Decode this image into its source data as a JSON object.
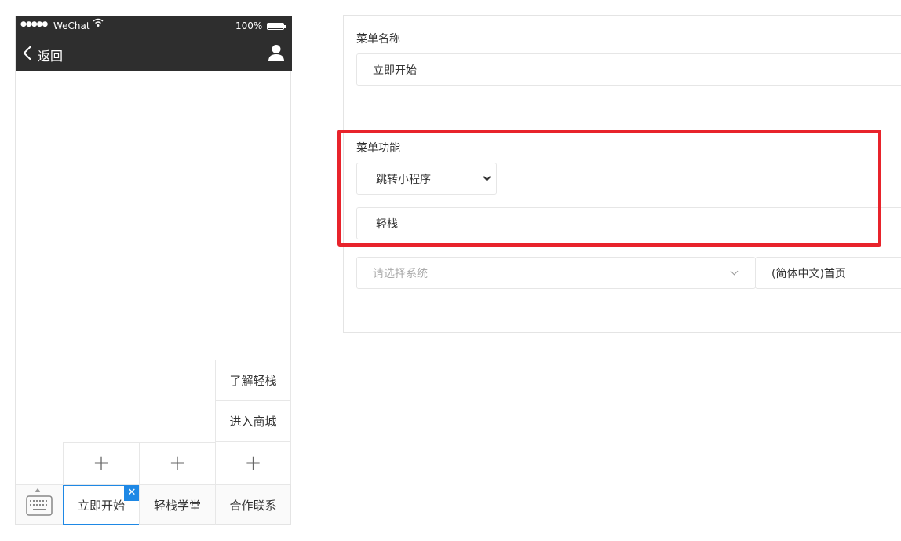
{
  "phone": {
    "status_bar": {
      "signal": "●●●●●",
      "carrier": "WeChat",
      "battery_percent": "100%"
    },
    "nav": {
      "back_label": "返回"
    },
    "submenu": [
      "了解轻栈",
      "进入商城"
    ],
    "add_symbol": "+",
    "main_menu": [
      {
        "label": "立即开始",
        "active": true
      },
      {
        "label": "轻栈学堂",
        "active": false
      },
      {
        "label": "合作联系",
        "active": false
      }
    ],
    "delete_symbol": "✕"
  },
  "form": {
    "menu_name_label": "菜单名称",
    "menu_name_value": "立即开始",
    "menu_function_label": "菜单功能",
    "function_select_value": "跳转小程序",
    "miniprogram_value": "轻栈",
    "system_select_placeholder": "请选择系统",
    "page_select_value": "(简体中文)首页"
  },
  "colors": {
    "accent": "#1e88e5",
    "highlight": "#e8232b",
    "nav_bg": "#2e2e2e"
  }
}
